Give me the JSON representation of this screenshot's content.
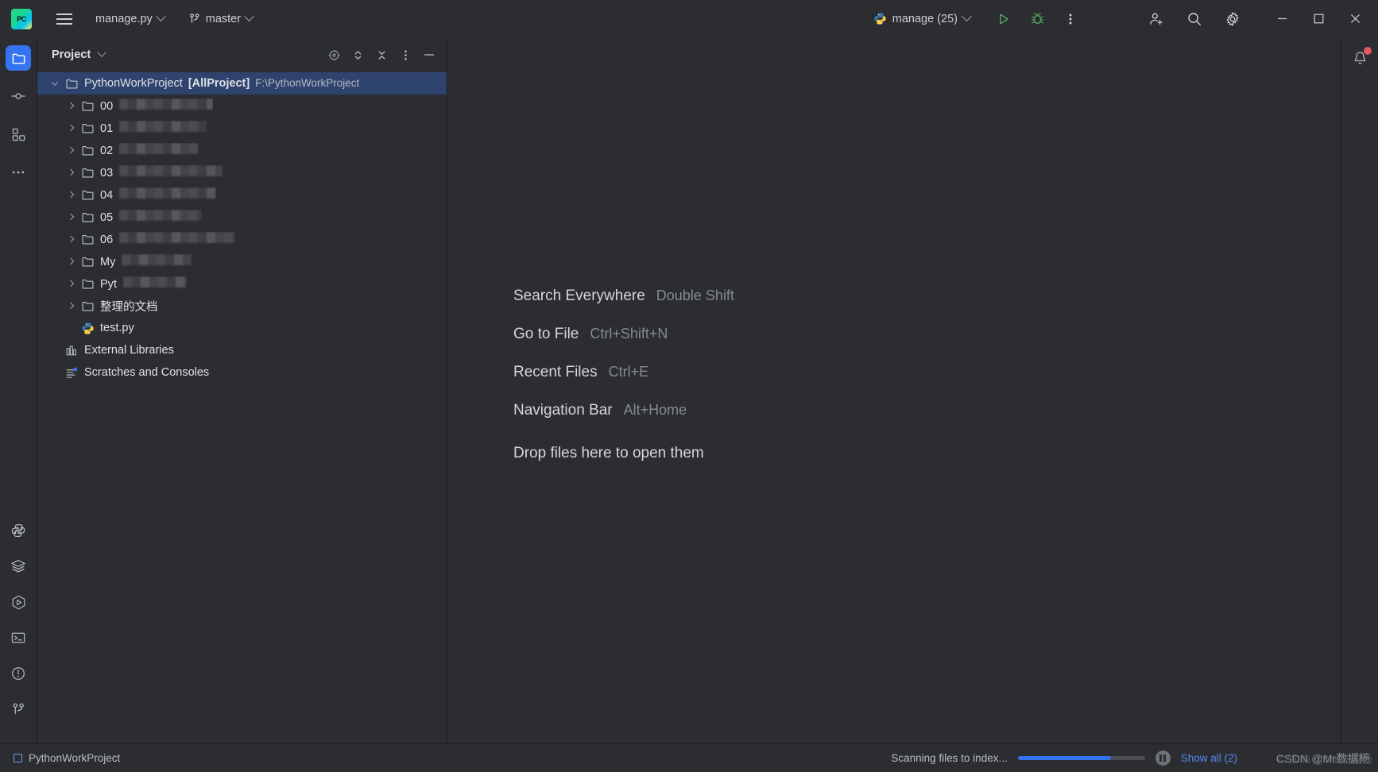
{
  "titlebar": {
    "logo_alt": "PyCharm",
    "menu_icon": "hamburger-menu-icon",
    "project_file": "manage.py",
    "branch": "master",
    "branch_icon": "git-branch-icon",
    "run_config": "manage (25)",
    "run_config_icon": "python-icon",
    "run_label": "Run",
    "debug_label": "Debug",
    "more_label": "More Actions",
    "share_label": "Code With Me",
    "search_label": "Search Everywhere",
    "settings_label": "Settings",
    "minimize_label": "Minimize",
    "maximize_label": "Maximize",
    "close_label": "Close"
  },
  "rail": {
    "top": [
      {
        "name": "project",
        "icon": "folder-icon",
        "active": true
      },
      {
        "name": "commit",
        "icon": "commit-icon",
        "active": false
      },
      {
        "name": "structure",
        "icon": "structure-icon",
        "active": false
      },
      {
        "name": "more-tool-windows",
        "icon": "ellipsis-icon",
        "active": false
      }
    ],
    "bottom": [
      {
        "name": "python-console",
        "icon": "python-console-icon"
      },
      {
        "name": "database",
        "icon": "layers-icon"
      },
      {
        "name": "run",
        "icon": "run-hex-icon"
      },
      {
        "name": "terminal",
        "icon": "terminal-icon"
      },
      {
        "name": "problems",
        "icon": "warning-circle-icon"
      },
      {
        "name": "version-control",
        "icon": "git-branch-icon"
      }
    ]
  },
  "right_rail": {
    "notifications_label": "Notifications",
    "notifications_icon": "bell-icon",
    "has_badge": true
  },
  "project_panel": {
    "title": "Project",
    "actions": [
      {
        "name": "select-opened-file",
        "icon": "crosshair-icon"
      },
      {
        "name": "expand-collapse",
        "icon": "updown-chevrons-icon"
      },
      {
        "name": "collapse-all",
        "icon": "collapse-all-icon"
      },
      {
        "name": "options",
        "icon": "vertical-ellipsis-icon"
      },
      {
        "name": "hide",
        "icon": "minimize-icon"
      }
    ],
    "tree": [
      {
        "name": "PythonWorkProject",
        "tag": "[AllProject]",
        "path": "F:\\PythonWorkProject",
        "icon": "folder-icon",
        "indent": 0,
        "expanded": true,
        "selected": true,
        "blurred": false
      },
      {
        "name": "00",
        "icon": "folder-icon",
        "indent": 1,
        "expanded": false,
        "selected": false,
        "blurred": true,
        "blur_width": 118
      },
      {
        "name": "01",
        "icon": "folder-icon",
        "indent": 1,
        "expanded": false,
        "selected": false,
        "blurred": true,
        "blur_width": 110
      },
      {
        "name": "02",
        "icon": "folder-icon",
        "indent": 1,
        "expanded": false,
        "selected": false,
        "blurred": true,
        "blur_width": 100
      },
      {
        "name": "03",
        "icon": "folder-icon",
        "indent": 1,
        "expanded": false,
        "selected": false,
        "blurred": true,
        "blur_width": 130
      },
      {
        "name": "04",
        "icon": "folder-icon",
        "indent": 1,
        "expanded": false,
        "selected": false,
        "blurred": true,
        "blur_width": 122
      },
      {
        "name": "05",
        "icon": "folder-icon",
        "indent": 1,
        "expanded": false,
        "selected": false,
        "blurred": true,
        "blur_width": 104
      },
      {
        "name": "06",
        "icon": "folder-icon",
        "indent": 1,
        "expanded": false,
        "selected": false,
        "blurred": true,
        "blur_width": 146
      },
      {
        "name": "My",
        "icon": "folder-icon",
        "indent": 1,
        "expanded": false,
        "selected": false,
        "blurred": true,
        "blur_width": 88
      },
      {
        "name": "Pyt",
        "icon": "folder-icon",
        "indent": 1,
        "expanded": false,
        "selected": false,
        "blurred": true,
        "blur_width": 80
      },
      {
        "name": "整理的文档",
        "icon": "folder-icon",
        "indent": 1,
        "expanded": false,
        "selected": false,
        "blurred": false
      },
      {
        "name": "test.py",
        "icon": "python-file-icon",
        "indent": 1,
        "leaf": true,
        "selected": false,
        "blurred": false
      },
      {
        "name": "External Libraries",
        "icon": "external-libraries-icon",
        "indent": 0,
        "leaf": true,
        "selected": false,
        "blurred": false
      },
      {
        "name": "Scratches and Consoles",
        "icon": "scratches-icon",
        "indent": 0,
        "leaf": true,
        "selected": false,
        "blurred": false
      }
    ]
  },
  "editor": {
    "shortcuts": [
      {
        "action": "Search Everywhere",
        "keys": "Double Shift"
      },
      {
        "action": "Go to File",
        "keys": "Ctrl+Shift+N"
      },
      {
        "action": "Recent Files",
        "keys": "Ctrl+E"
      },
      {
        "action": "Navigation Bar",
        "keys": "Alt+Home"
      }
    ],
    "drop_hint": "Drop files here to open them"
  },
  "statusbar": {
    "project_name": "PythonWorkProject",
    "indexing_text": "Scanning files to index...",
    "progress_percent": 73,
    "pause_label": "Pause",
    "show_all": "Show all (2)",
    "watermark": "CSDN @Mr数据杨"
  },
  "colors": {
    "background": "#2b2d30",
    "selection": "#2e436e",
    "accent": "#3574f0",
    "link": "#548af7",
    "run_green": "#59a869",
    "badge_red": "#e55765",
    "border": "#1e1f22"
  }
}
